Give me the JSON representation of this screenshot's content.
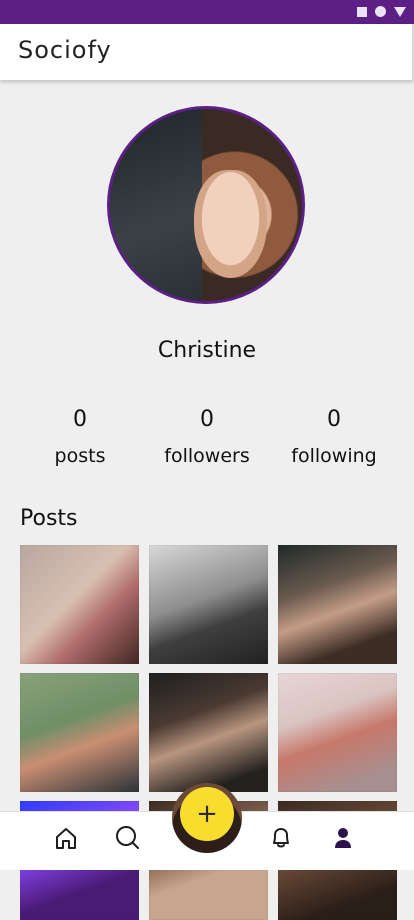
{
  "colors": {
    "accent": "#5b1f86",
    "fab": "#f8dc2e",
    "nav_active": "#2b1150"
  },
  "app": {
    "brand": "Sociofy"
  },
  "profile": {
    "name": "Christine"
  },
  "stats": [
    {
      "value": "0",
      "label": "posts"
    },
    {
      "value": "0",
      "label": "followers"
    },
    {
      "value": "0",
      "label": "following"
    }
  ],
  "posts_section": {
    "title": "Posts"
  },
  "bottom_nav": {
    "items": [
      {
        "icon": "home-icon"
      },
      {
        "icon": "search-icon"
      },
      {
        "icon": "add-icon",
        "label": "+"
      },
      {
        "icon": "bell-icon"
      },
      {
        "icon": "profile-icon"
      }
    ]
  },
  "posts": [
    {
      "icon": "photo-thumbnail"
    },
    {
      "icon": "photo-thumbnail"
    },
    {
      "icon": "photo-thumbnail"
    },
    {
      "icon": "photo-thumbnail"
    },
    {
      "icon": "photo-thumbnail"
    },
    {
      "icon": "photo-thumbnail"
    },
    {
      "icon": "photo-thumbnail"
    },
    {
      "icon": "photo-thumbnail"
    },
    {
      "icon": "photo-thumbnail"
    }
  ]
}
